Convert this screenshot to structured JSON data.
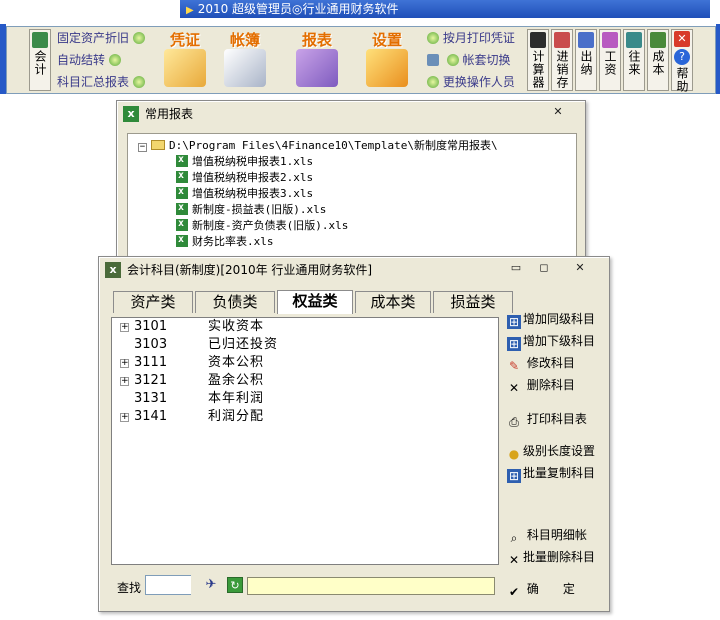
{
  "app": {
    "title": "2010 超级管理员◎行业通用财务软件"
  },
  "toolbar": {
    "kuaiji": "会计",
    "links_left": [
      "固定资产折旧",
      "自动结转",
      "科目汇总报表"
    ],
    "big": [
      "凭证",
      "帐簿",
      "报表",
      "设置"
    ],
    "links_right": [
      "按月打印凭证",
      "帐套切换",
      "更换操作人员"
    ],
    "vbuttons": [
      "计算器",
      "进销存",
      "出纳",
      "工资",
      "往来",
      "成本",
      "帮助"
    ]
  },
  "report_window": {
    "title": "常用报表",
    "root": "D:\\Program Files\\4Finance10\\Template\\新制度常用报表\\",
    "files": [
      "增值税纳税申报表1.xls",
      "增值税纳税申报表2.xls",
      "增值税纳税申报表3.xls",
      "新制度-损益表(旧版).xls",
      "新制度-资产负债表(旧版).xls",
      "财务比率表.xls"
    ]
  },
  "accounts_window": {
    "title": "会计科目(新制度)[2010年 行业通用财务软件]",
    "tabs": [
      "资产类",
      "负债类",
      "权益类",
      "成本类",
      "损益类"
    ],
    "active_tab": "权益类",
    "rows": [
      {
        "code": "3101",
        "name": "实收资本",
        "expandable": true
      },
      {
        "code": "3103",
        "name": "已归还投资",
        "expandable": false
      },
      {
        "code": "3111",
        "name": "资本公积",
        "expandable": true
      },
      {
        "code": "3121",
        "name": "盈余公积",
        "expandable": true
      },
      {
        "code": "3131",
        "name": "本年利润",
        "expandable": false
      },
      {
        "code": "3141",
        "name": "利润分配",
        "expandable": true
      }
    ],
    "actions": [
      "增加同级科目",
      "增加下级科目",
      "修改科目",
      "删除科目",
      "打印科目表",
      "级别长度设置",
      "批量复制科目",
      "科目明细帐",
      "批量删除科目",
      "确　　定"
    ],
    "find_label": "查找",
    "find_value": ""
  }
}
